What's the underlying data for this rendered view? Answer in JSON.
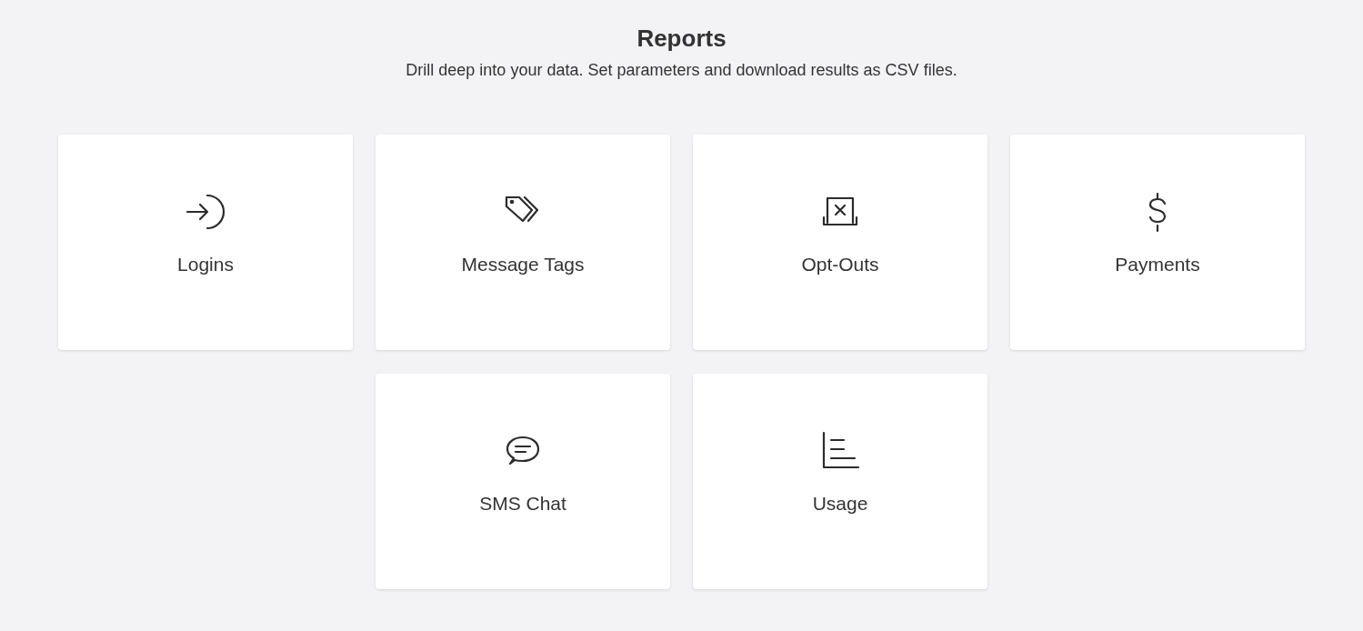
{
  "header": {
    "title": "Reports",
    "subtitle": "Drill deep into your data. Set parameters and download results as CSV files."
  },
  "rows": [
    [
      {
        "label": "Logins"
      },
      {
        "label": "Message Tags"
      },
      {
        "label": "Opt-Outs"
      },
      {
        "label": "Payments"
      }
    ],
    [
      {
        "label": "SMS Chat"
      },
      {
        "label": "Usage"
      }
    ]
  ]
}
